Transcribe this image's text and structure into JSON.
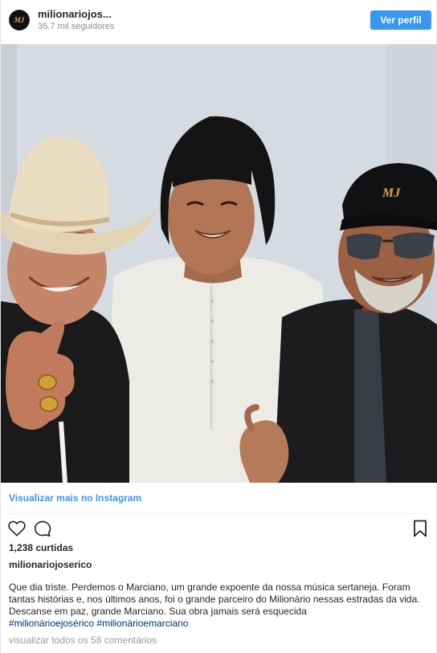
{
  "header": {
    "avatar_text": "MJ",
    "username": "milionariojos...",
    "followers": "35.7 mil seguidores",
    "view_profile_label": "Ver perfil"
  },
  "view_more_label": "Visualizar mais no Instagram",
  "likes": "1,238 curtidas",
  "caption_user": "milionariojoserico",
  "caption_text": "Que dia triste. Perdemos o Marciano, um grande expoente da nossa música sertaneja. Foram tantas histórias e, nos últimos anos, foi o grande parceiro do Milionário nessas estradas da vida. Descanse em paz, grande Marciano. Sua obra jamais será esquecida",
  "hashtags": [
    "#milionárioejosérico",
    "#milionárioemarciano"
  ],
  "comments_link": "visualizar todos os 58 comentários",
  "cap_logo_text": "MJ",
  "colors": {
    "accent": "#3897f0",
    "hashtag": "#003569",
    "muted": "#999999"
  }
}
